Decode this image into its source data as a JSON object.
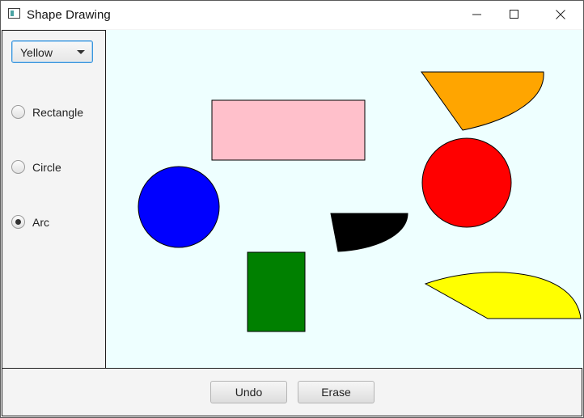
{
  "window": {
    "title": "Shape Drawing"
  },
  "sidebar": {
    "color_select": {
      "value": "Yellow"
    },
    "shape_options": [
      {
        "label": "Rectangle",
        "selected": false
      },
      {
        "label": "Circle",
        "selected": false
      },
      {
        "label": "Arc",
        "selected": true
      }
    ]
  },
  "canvas": {
    "background": "#eeffff",
    "shapes": [
      {
        "kind": "rectangle",
        "fill": "#ffc0cb"
      },
      {
        "kind": "circle",
        "fill": "#0000ff"
      },
      {
        "kind": "rectangle",
        "fill": "#008000"
      },
      {
        "kind": "arc",
        "fill": "#000000"
      },
      {
        "kind": "arc",
        "fill": "#ffa500"
      },
      {
        "kind": "circle",
        "fill": "#ff0000"
      },
      {
        "kind": "arc",
        "fill": "#ffff00"
      }
    ]
  },
  "toolbar": {
    "undo_label": "Undo",
    "erase_label": "Erase"
  }
}
